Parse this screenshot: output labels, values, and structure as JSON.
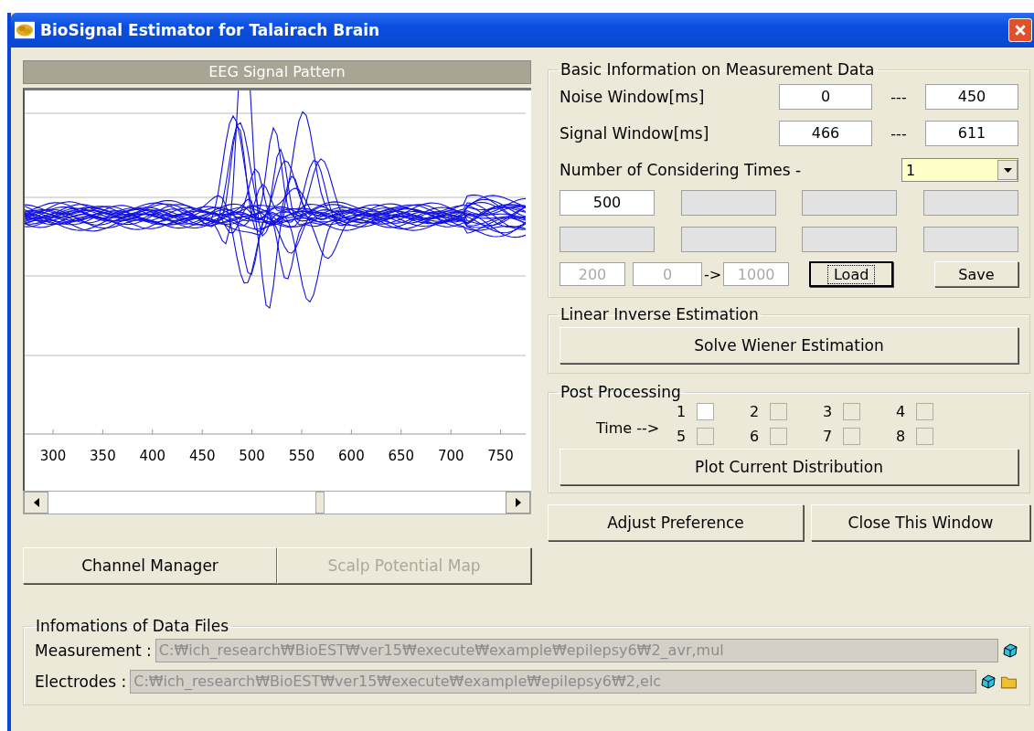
{
  "window": {
    "title": "BioSignal Estimator for Talairach Brain"
  },
  "signal_panel": {
    "title": "EEG Signal Pattern",
    "x_ticks": [
      "300",
      "350",
      "400",
      "450",
      "500",
      "550",
      "600",
      "650",
      "700",
      "750"
    ],
    "buttons": [
      {
        "label": "Channel Manager",
        "disabled": false
      },
      {
        "label": "Scalp Potential Map",
        "disabled": true
      }
    ]
  },
  "basic_info": {
    "title": "Basic Information on Measurement Data",
    "windows": [
      {
        "label": "Noise Window[ms]",
        "from": "0",
        "separator": "---",
        "to": "450"
      },
      {
        "label": "Signal Window[ms]",
        "from": "466",
        "separator": "---",
        "to": "611"
      }
    ],
    "times_label": "Number of Considering Times -",
    "times_value": "1",
    "time_fields": [
      {
        "value": "500",
        "disabled": false
      },
      {
        "disabled": true
      },
      {
        "disabled": true
      },
      {
        "disabled": true
      },
      {
        "disabled": true
      },
      {
        "disabled": true
      },
      {
        "disabled": true
      },
      {
        "disabled": true
      }
    ],
    "range": {
      "step": "200",
      "from": "0",
      "arrow": "->",
      "to": "1000",
      "disabled": true
    },
    "buttons": [
      {
        "label": "Load",
        "focused": true
      },
      {
        "label": "Save",
        "focused": false
      }
    ]
  },
  "linear_inverse": {
    "title": "Linear Inverse Estimation",
    "button": "Solve Wiener Estimation"
  },
  "post_processing": {
    "title": "Post Processing",
    "time_label": "Time -->",
    "times": [
      {
        "label": "1",
        "checked": false,
        "disabled": false
      },
      {
        "label": "2",
        "checked": false,
        "disabled": true
      },
      {
        "label": "3",
        "checked": false,
        "disabled": true
      },
      {
        "label": "4",
        "checked": false,
        "disabled": true
      },
      {
        "label": "5",
        "checked": false,
        "disabled": true
      },
      {
        "label": "6",
        "checked": false,
        "disabled": true
      },
      {
        "label": "7",
        "checked": false,
        "disabled": true
      },
      {
        "label": "8",
        "checked": false,
        "disabled": true
      }
    ],
    "button": "Plot Current Distribution"
  },
  "actions": [
    "Adjust Preference",
    "Close This Window"
  ],
  "data_files": {
    "title": "Infomations of Data Files",
    "files": [
      {
        "label": "Measurement :",
        "path": "C:₩ich_research₩BioEST₩ver15₩execute₩example₩epilepsy6₩2_avr,mul",
        "folder": false
      },
      {
        "label": "Electrodes :",
        "path": "C:₩ich_research₩BioEST₩ver15₩execute₩example₩epilepsy6₩2,elc",
        "folder": true
      }
    ]
  }
}
